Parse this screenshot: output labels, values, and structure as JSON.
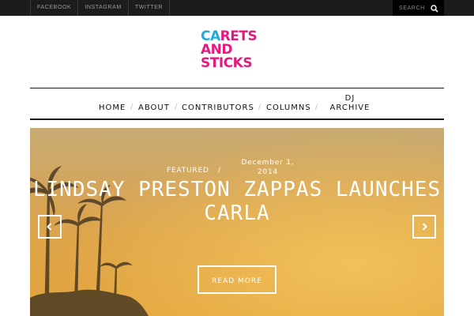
{
  "top_bar": {
    "social_links": [
      "FACEBOOK",
      "INSTAGRAM",
      "TWITTER"
    ],
    "search_placeholder": "SEARCH"
  },
  "logo": {
    "line1_accent": "CA",
    "line1_rest": "RETS",
    "line2": "AND",
    "line3": "STICKS"
  },
  "nav": {
    "items": [
      "HOME",
      "ABOUT",
      "CONTRIBUTORS",
      "COLUMNS",
      "DJ ARCHIVE"
    ],
    "separator": "/"
  },
  "featured_post": {
    "category": "FEATURED",
    "separator": "/",
    "date": "December 1, 2014",
    "title": "LINDSAY PRESTON ZAPPAS LAUNCHES CARLA",
    "read_more_label": "READ MORE"
  },
  "slider": {
    "prev_icon": "chevron-left-icon",
    "next_icon": "chevron-right-icon"
  },
  "colors": {
    "brand_pink": "#e6197e",
    "brand_blue": "#1ea9e0",
    "topbar_bg": "#1c1c1c"
  }
}
